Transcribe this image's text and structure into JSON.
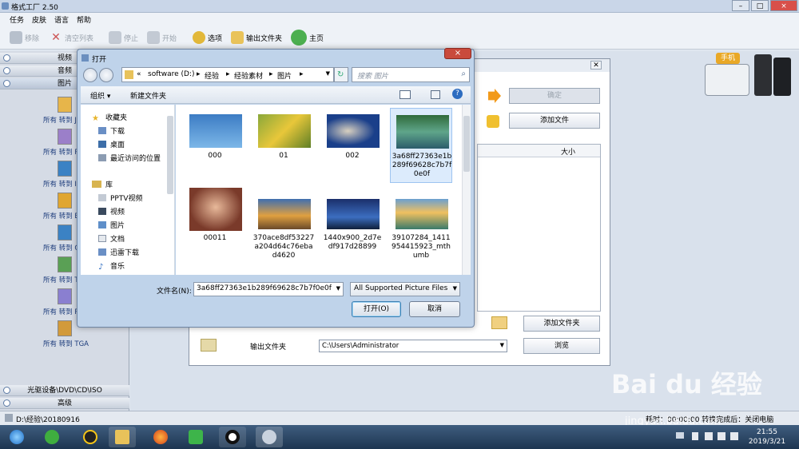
{
  "app": {
    "title": "格式工厂 2.50",
    "window_buttons": [
      "–",
      "□",
      "×"
    ]
  },
  "menu": [
    "任务",
    "皮肤",
    "语言",
    "帮助"
  ],
  "toolbar": {
    "remove": "移除",
    "clear": "清空列表",
    "stop": "停止",
    "start": "开始",
    "options": "选项",
    "output_folder": "输出文件夹",
    "home": "主页"
  },
  "sidebar": {
    "categories": [
      "视频",
      "音频",
      "图片"
    ],
    "formats": [
      {
        "tag": "JPG",
        "label": "所有 转到 JPG"
      },
      {
        "tag": "PNG",
        "label": "所有 转到 PNG"
      },
      {
        "tag": "ICO",
        "label": "所有 转到 ICO"
      },
      {
        "tag": "BMP",
        "label": "所有 转到 BMP"
      },
      {
        "tag": "GIF",
        "label": "所有 转到 GIF"
      },
      {
        "tag": "TIF",
        "label": "所有 转到 TIF"
      },
      {
        "tag": "PCX",
        "label": "所有 转到 PCX"
      },
      {
        "tag": "TGA",
        "label": "所有 转到 TGA"
      }
    ],
    "bottom": [
      "光驱设备\\DVD\\CD\\ISO",
      "高级"
    ]
  },
  "status": {
    "path": "D:\\经验\\20180916",
    "right": "耗时：00:00:00   转换完成后：关闭电脑"
  },
  "bg_dialog": {
    "ok": "确定",
    "add_file": "添加文件",
    "size_col": "大小",
    "add_folder": "添加文件夹",
    "output_label": "输出文件夹",
    "output_value": "C:\\Users\\Administrator",
    "browse": "浏览"
  },
  "dialog": {
    "title": "打开",
    "close": "×",
    "breadcrumb": [
      "«",
      "software (D:)",
      "经验",
      "经验素材",
      "图片"
    ],
    "search_placeholder": "搜索 图片",
    "organize": "组织 ▾",
    "new_folder": "新建文件夹",
    "nav": {
      "favorites": "收藏夹",
      "favorites_items": [
        "下载",
        "桌面",
        "最近访问的位置"
      ],
      "libraries": "库",
      "library_items": [
        "PPTV视频",
        "视频",
        "图片",
        "文档",
        "迅雷下载",
        "音乐"
      ]
    },
    "files": [
      {
        "name": "000"
      },
      {
        "name": "01"
      },
      {
        "name": "002"
      },
      {
        "name": "3a68ff27363e1b289f69628c7b7f0e0f",
        "selected": true
      },
      {
        "name": "00011"
      },
      {
        "name": "370ace8df53227a204d64c76ebad4620"
      },
      {
        "name": "1440x900_2d7edf917d28899"
      },
      {
        "name": "39107284_1411954415923_mthumb"
      }
    ],
    "filename_label": "文件名(N):",
    "filename_value": "3a68ff27363e1b289f69628c7b7f0e0f",
    "filetype": "All Supported Picture Files",
    "open": "打开(O)",
    "cancel": "取消"
  },
  "taskbar": {
    "time": "21:55",
    "date": "2019/3/21"
  },
  "watermark": {
    "brand": "Bai du 经验",
    "site": "jingyan.baidu.com"
  }
}
